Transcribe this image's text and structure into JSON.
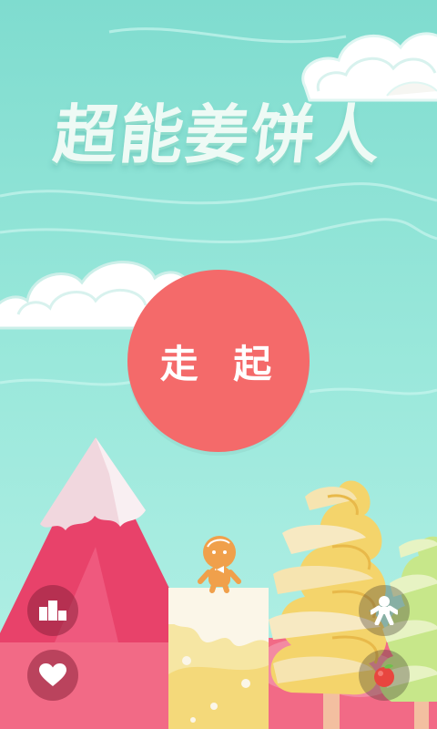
{
  "game": {
    "title": "超能姜饼人",
    "play_label": "走 起"
  },
  "icons": {
    "leaderboard": "podium-icon",
    "favorite": "heart-icon",
    "character": "gingerbread-man-icon",
    "fruit": "apple-icon"
  },
  "colors": {
    "sky": "#93e6d6",
    "play_button": "#f46a6a",
    "mountain": "#e8426a",
    "snow_cap": "#f1d7de",
    "title_text": "#eefaf5",
    "cake": "#f6e6a3",
    "gingerbread": "#f0a04b"
  }
}
